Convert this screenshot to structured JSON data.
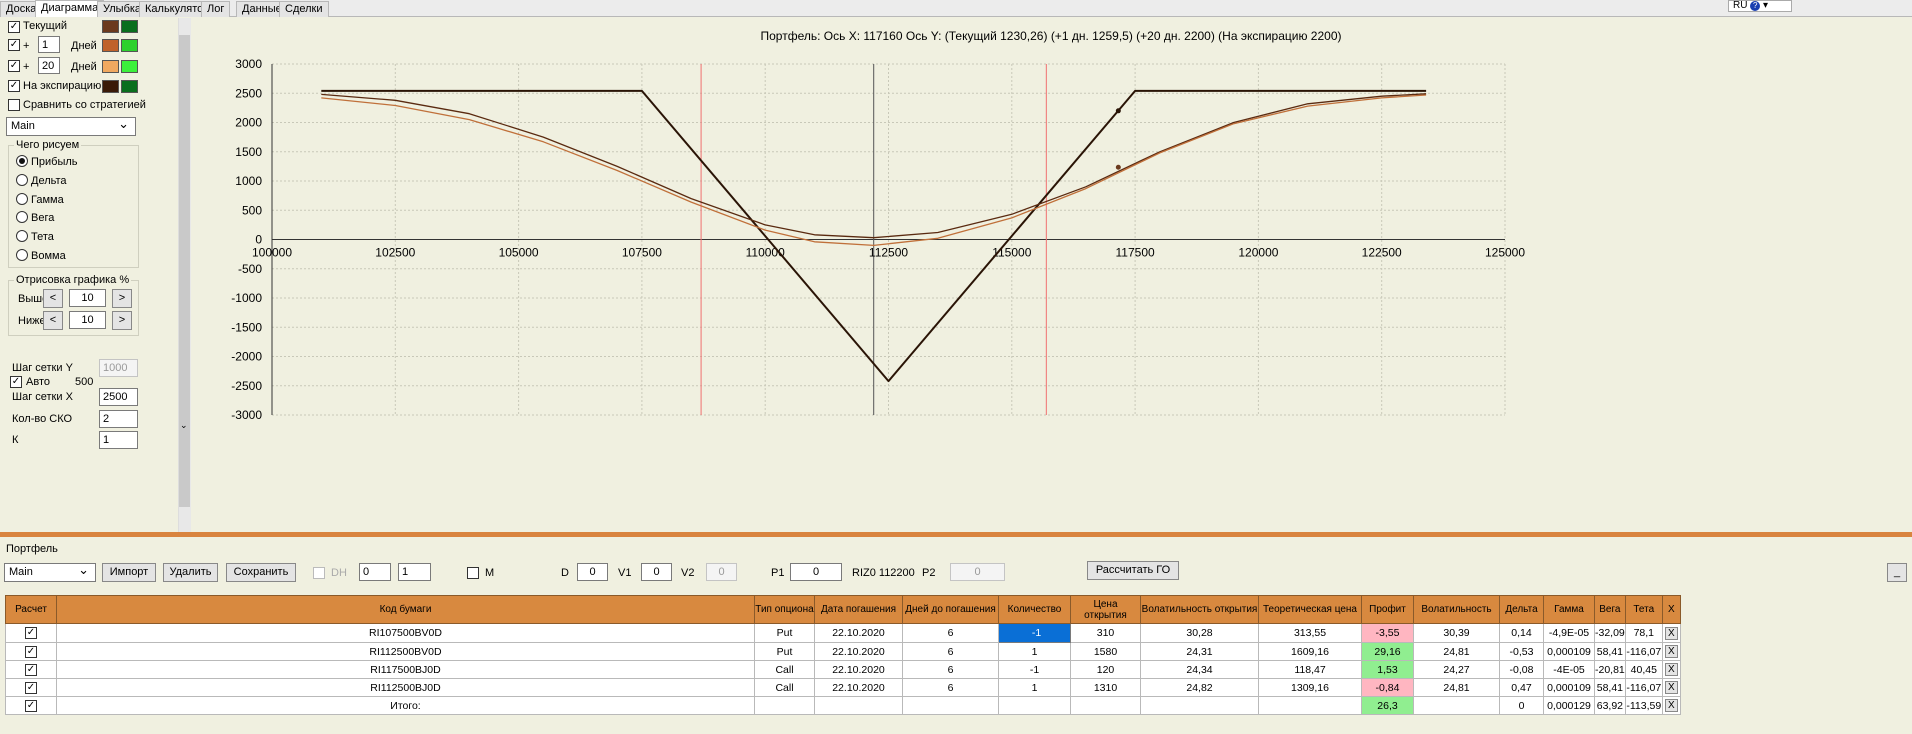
{
  "tabs": [
    "Доска",
    "Диаграмма",
    "Улыбка",
    "Калькулятор",
    "Лог",
    "Данные",
    "Сделки"
  ],
  "active_tab": 1,
  "lang": "RU",
  "left": {
    "current": {
      "label": "Текущий",
      "checked": true
    },
    "plus1": {
      "label": "+",
      "value": "1",
      "unit": "Дней",
      "checked": true
    },
    "plus2": {
      "label": "+",
      "value": "20",
      "unit": "Дней",
      "checked": true
    },
    "expiry": {
      "label": "На экспирацию",
      "checked": true
    },
    "compare": {
      "label": "Сравнить со стратегией",
      "checked": false
    },
    "strategy": "Main",
    "draw_group": "Чего рисуем",
    "draw_options": [
      "Прибыль",
      "Дельта",
      "Гамма",
      "Вега",
      "Тета",
      "Вомма"
    ],
    "draw_selected": 0,
    "render_group": "Отрисовка графика %",
    "above_label": "Выше",
    "above_value": "10",
    "below_label": "Ниже",
    "below_value": "10",
    "btn_left": "<",
    "btn_right": ">",
    "grid_y_label": "Шаг сетки Y",
    "grid_y_value": "1000",
    "auto_label": "Авто",
    "auto_value": "500",
    "grid_x_label": "Шаг сетки X",
    "grid_x_value": "2500",
    "sko_label": "Кол-во СКО",
    "sko_value": "2",
    "extra_label": "К",
    "extra_value": "1"
  },
  "colors": {
    "current": [
      "#6b3a1e",
      "#0a6e1e"
    ],
    "plus1": [
      "#c0622a",
      "#2dd12d"
    ],
    "plus2": [
      "#f0a860",
      "#3cf03c"
    ],
    "expiry": [
      "#3a1a08",
      "#0a6e1e"
    ]
  },
  "chart_data": {
    "type": "line",
    "title": "Портфель: Ось X: 117160 Ось Y:  (Текущий 1230,26)  (+1 дн. 1259,5)  (+20  дн. 2200)  (На экспирацию 2200)",
    "xlim": [
      100000,
      125000
    ],
    "ylim": [
      -3000,
      3000
    ],
    "x_ticks": [
      100000,
      102500,
      105000,
      107500,
      110000,
      112500,
      115000,
      117500,
      120000,
      122500,
      125000
    ],
    "x_tick_labels": [
      "100000",
      "102500",
      "105000",
      "107500",
      "110000",
      "112500",
      "115000",
      "117500",
      "120000",
      "122500",
      "125000"
    ],
    "y_ticks": [
      3000,
      2500,
      2000,
      1500,
      1000,
      500,
      0,
      -500,
      -1000,
      -1500,
      -2000,
      -2500,
      -3000
    ],
    "y_tick_labels": [
      "3000",
      "2500",
      "2000",
      "1500",
      "1000",
      "500",
      "0",
      "-500",
      "-1000",
      "-1500",
      "-2000",
      "-2500",
      "-3000"
    ],
    "cursor_x": 117160,
    "center_line_x": 112200,
    "red_lines_x": [
      108700,
      115700
    ],
    "series": [
      {
        "key": "expiry",
        "color": "#2a1406",
        "points": [
          [
            101000,
            2540
          ],
          [
            107500,
            2540
          ],
          [
            112500,
            -2420
          ],
          [
            117500,
            2540
          ],
          [
            123400,
            2540
          ]
        ]
      },
      {
        "key": "current",
        "color": "#5a2a10",
        "points": [
          [
            101000,
            2480
          ],
          [
            102500,
            2380
          ],
          [
            104000,
            2150
          ],
          [
            105500,
            1750
          ],
          [
            107000,
            1250
          ],
          [
            108500,
            700
          ],
          [
            110000,
            250
          ],
          [
            111000,
            80
          ],
          [
            112200,
            30
          ],
          [
            113500,
            120
          ],
          [
            115000,
            430
          ],
          [
            116500,
            900
          ],
          [
            118000,
            1500
          ],
          [
            119500,
            2000
          ],
          [
            121000,
            2320
          ],
          [
            122500,
            2450
          ],
          [
            123400,
            2490
          ]
        ]
      },
      {
        "key": "plus1",
        "color": "#c0703a",
        "points": [
          [
            101000,
            2420
          ],
          [
            102500,
            2290
          ],
          [
            104000,
            2050
          ],
          [
            105500,
            1670
          ],
          [
            107000,
            1180
          ],
          [
            108500,
            640
          ],
          [
            110000,
            160
          ],
          [
            111000,
            -40
          ],
          [
            112200,
            -100
          ],
          [
            113500,
            20
          ],
          [
            115000,
            370
          ],
          [
            116500,
            870
          ],
          [
            118000,
            1480
          ],
          [
            119500,
            1980
          ],
          [
            121000,
            2280
          ],
          [
            122500,
            2420
          ],
          [
            123400,
            2470
          ]
        ]
      }
    ],
    "markers": [
      {
        "x": 117160,
        "y": 2200,
        "color": "#2a1406"
      },
      {
        "x": 117160,
        "y": 1235,
        "color": "#6b3a1e"
      }
    ]
  },
  "portfolio": {
    "label": "Портфель",
    "strategy": "Main",
    "import": "Импорт",
    "delete": "Удалить",
    "save": "Сохранить",
    "dh_label": "DH",
    "dh_v1": "0",
    "dh_v2": "1",
    "m_label": "M",
    "d_label": "D",
    "d_value": "0",
    "v1_label": "V1",
    "v1_value": "0",
    "v2_label": "V2",
    "v2_value": "0",
    "p1_label": "P1",
    "p1_value": "0",
    "riz_label": "RIZ0 112200",
    "p2_label": "P2",
    "p2_value": "0",
    "calc": "Рассчитать ГО",
    "minimize": "_"
  },
  "table": {
    "headers": [
      "Расчет",
      "Код бумаги",
      "Тип опциона",
      "Дата погашения",
      "Дней до погашения",
      "Количество",
      "Цена открытия",
      "Волатильность открытия",
      "Теоретическая цена",
      "Профит",
      "Волатильность",
      "Дельта",
      "Гамма",
      "Вега",
      "Тета",
      "X"
    ],
    "rows": [
      [
        "✓",
        "RI107500BV0D",
        "Put",
        "22.10.2020",
        "6",
        "-1",
        "310",
        "30,28",
        "313,55",
        "-3,55",
        "30,39",
        "0,14",
        "-4,9E-05",
        "-32,09",
        "78,1",
        "X"
      ],
      [
        "✓",
        "RI112500BV0D",
        "Put",
        "22.10.2020",
        "6",
        "1",
        "1580",
        "24,31",
        "1609,16",
        "29,16",
        "24,81",
        "-0,53",
        "0,000109",
        "58,41",
        "-116,07",
        "X"
      ],
      [
        "✓",
        "RI117500BJ0D",
        "Call",
        "22.10.2020",
        "6",
        "-1",
        "120",
        "24,34",
        "118,47",
        "1,53",
        "24,27",
        "-0,08",
        "-4E-05",
        "-20,81",
        "40,45",
        "X"
      ],
      [
        "✓",
        "RI112500BJ0D",
        "Call",
        "22.10.2020",
        "6",
        "1",
        "1310",
        "24,82",
        "1309,16",
        "-0,84",
        "24,81",
        "0,47",
        "0,000109",
        "58,41",
        "-116,07",
        "X"
      ]
    ],
    "total": [
      "✓",
      "Итого:",
      "",
      "",
      "",
      "",
      "",
      "",
      "",
      "26,3",
      "",
      "0",
      "0,000129",
      "63,92",
      "-113,59",
      "X"
    ]
  }
}
